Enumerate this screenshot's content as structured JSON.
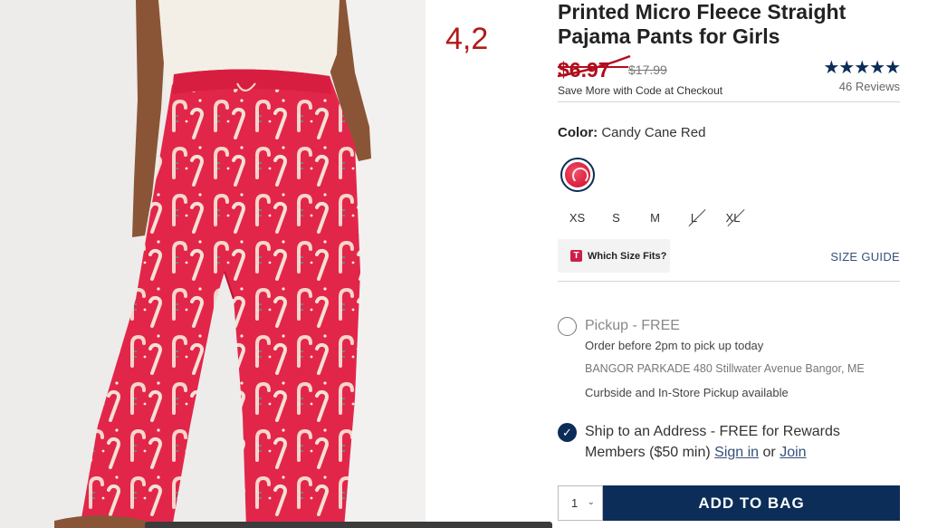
{
  "annotation": "4,2",
  "product": {
    "title": "Printed Micro Fleece Straight Pajama Pants for Girls",
    "sale_price": "$6.97",
    "original_price": "$17.99",
    "promo": "Save More with Code at Checkout",
    "rating_stars": "★★★★★",
    "reviews": "46 Reviews"
  },
  "color": {
    "label": "Color:",
    "value": "Candy Cane Red"
  },
  "sizes": [
    {
      "label": "XS",
      "available": true
    },
    {
      "label": "S",
      "available": true
    },
    {
      "label": "M",
      "available": true
    },
    {
      "label": "L",
      "available": false
    },
    {
      "label": "XL",
      "available": false
    }
  ],
  "fit": {
    "logo": "T",
    "label": "Which Size Fits?",
    "size_guide": "SIZE GUIDE"
  },
  "pickup": {
    "title": "Pickup - FREE",
    "line1": "Order before 2pm to pick up today",
    "address": "BANGOR PARKADE 480 Stillwater Avenue  Bangor, ME",
    "line3": "Curbside and In-Store Pickup available"
  },
  "ship": {
    "check": "✓",
    "text": "Ship to an Address - FREE for Rewards Members ($50 min)",
    "sign_in": "Sign in",
    "or": "or",
    "join": "Join"
  },
  "cart": {
    "quantity": "1",
    "add_label": "ADD TO BAG"
  },
  "colors": {
    "navy": "#0b2d58",
    "sale_red": "#b10d1d",
    "pant_red": "#e2264a"
  }
}
